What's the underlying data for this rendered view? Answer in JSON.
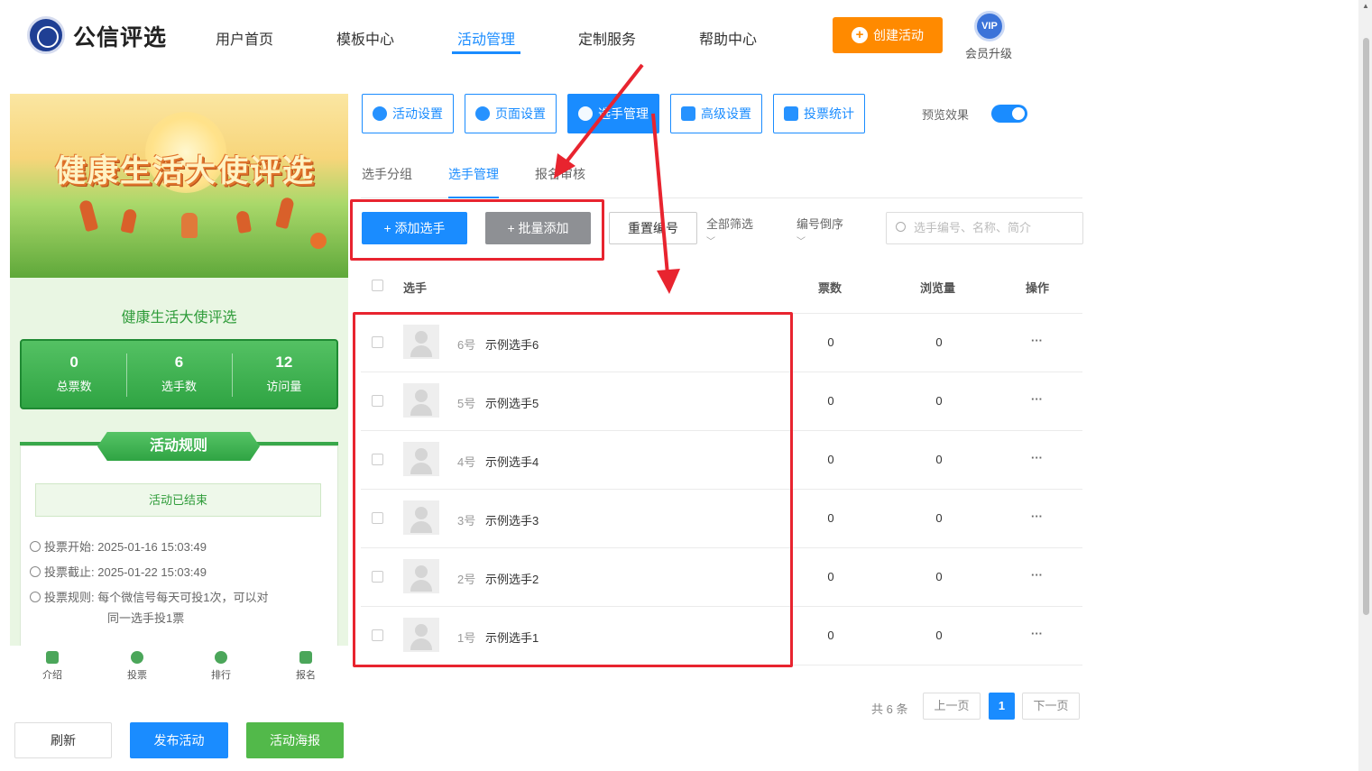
{
  "header": {
    "logo_text": "公信评选",
    "nav": [
      "用户首页",
      "模板中心",
      "活动管理",
      "定制服务",
      "帮助中心"
    ],
    "active_nav": "活动管理",
    "create_button": "创建活动",
    "vip_badge": "VIP",
    "vip_label": "会员升级"
  },
  "preview": {
    "banner_title": "健康生活大使评选",
    "title": "健康生活大使评选",
    "stats": [
      {
        "value": "0",
        "label": "总票数"
      },
      {
        "value": "6",
        "label": "选手数"
      },
      {
        "value": "12",
        "label": "访问量"
      }
    ],
    "rules_title": "活动规则",
    "status": "活动已结束",
    "vote_start_label": "投票开始:",
    "vote_start": "2025-01-16 15:03:49",
    "vote_end_label": "投票截止:",
    "vote_end": "2025-01-22 15:03:49",
    "vote_rule_label": "投票规则:",
    "vote_rule_line1": "每个微信号每天可投1次，可以对",
    "vote_rule_line2": "同一选手投1票",
    "tabbar": [
      "介绍",
      "投票",
      "排行",
      "报名"
    ]
  },
  "actions": {
    "refresh": "刷新",
    "publish": "发布活动",
    "poster": "活动海报"
  },
  "settings_tabs": [
    "活动设置",
    "页面设置",
    "选手管理",
    "高级设置",
    "投票统计"
  ],
  "active_settings_tab": "选手管理",
  "preview_toggle": {
    "label": "预览效果",
    "on": true
  },
  "sub_tabs": [
    "选手分组",
    "选手管理",
    "报名审核"
  ],
  "active_sub_tab": "选手管理",
  "toolbar": {
    "add": "添加选手",
    "batch_add": "批量添加",
    "renumber": "重置编号",
    "filter": "全部筛选",
    "sort": "编号倒序",
    "search_placeholder": "选手编号、名称、简介"
  },
  "table": {
    "columns": [
      "选手",
      "票数",
      "浏览量",
      "操作"
    ],
    "rows": [
      {
        "num": "6号",
        "name": "示例选手6",
        "votes": "0",
        "views": "0",
        "action": "···"
      },
      {
        "num": "5号",
        "name": "示例选手5",
        "votes": "0",
        "views": "0",
        "action": "···"
      },
      {
        "num": "4号",
        "name": "示例选手4",
        "votes": "0",
        "views": "0",
        "action": "···"
      },
      {
        "num": "3号",
        "name": "示例选手3",
        "votes": "0",
        "views": "0",
        "action": "···"
      },
      {
        "num": "2号",
        "name": "示例选手2",
        "votes": "0",
        "views": "0",
        "action": "···"
      },
      {
        "num": "1号",
        "name": "示例选手1",
        "votes": "0",
        "views": "0",
        "action": "···"
      }
    ]
  },
  "pagination": {
    "total": "共 6 条",
    "prev": "上一页",
    "current": "1",
    "next": "下一页"
  },
  "colors": {
    "primary": "#1a8cff",
    "orange": "#ff8a00",
    "green": "#52b94a",
    "annotation_red": "#e8242f"
  }
}
